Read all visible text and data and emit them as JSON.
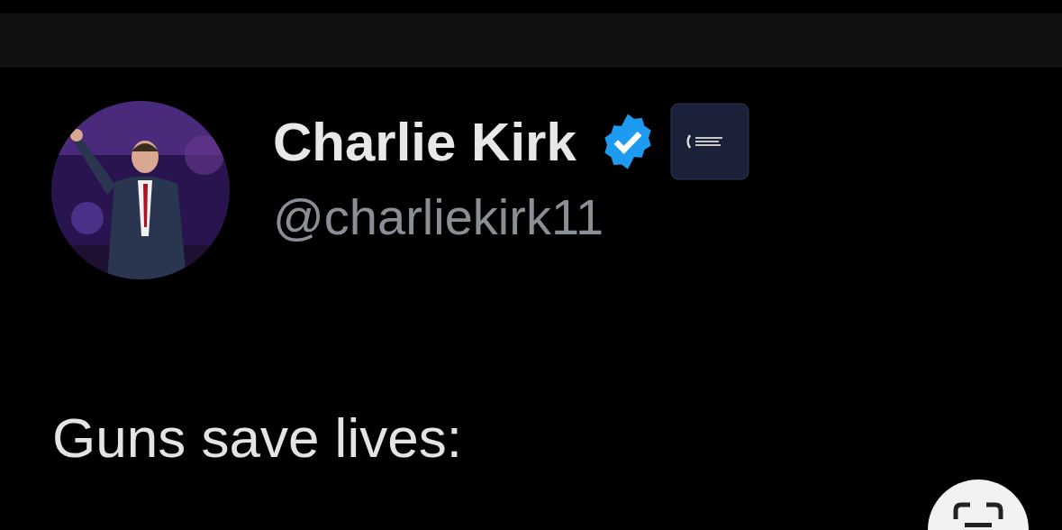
{
  "author": {
    "name": "Charlie Kirk",
    "handle": "@charliekirk11",
    "verified": true
  },
  "post": {
    "text": "Guns save lives:"
  }
}
